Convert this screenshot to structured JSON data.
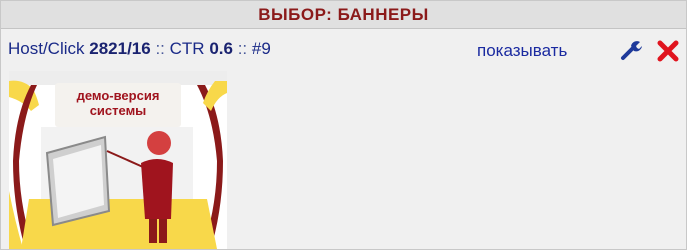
{
  "header": {
    "title": "ВЫБОР: БАННЕРЫ"
  },
  "stats": {
    "host_click_label": "Host/Click",
    "host_click_value": "2821/16",
    "separator_1": "::",
    "ctr_label": "CTR",
    "ctr_value": "0.6",
    "separator_2": "::",
    "index": "#9"
  },
  "actions": {
    "show_label": "показывать",
    "edit_icon": "wrench-icon",
    "delete_icon": "close-icon",
    "edit_color": "#1e3a9a",
    "delete_color": "#e0141e"
  },
  "banner": {
    "line1": "демо-версия",
    "line2": "системы",
    "accent_color": "#a0141e",
    "yellow_color": "#f8d84a"
  }
}
